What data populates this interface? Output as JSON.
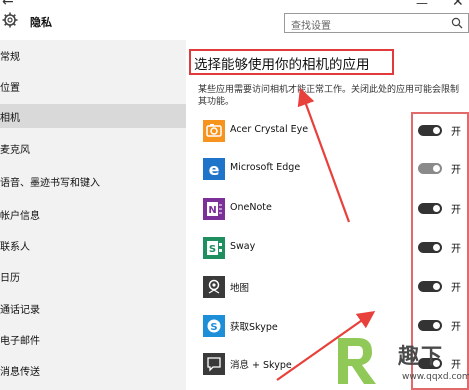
{
  "window": {
    "title": "隐私",
    "search_placeholder": "查找设置"
  },
  "sidebar": {
    "items": [
      {
        "label": "常规"
      },
      {
        "label": "位置"
      },
      {
        "label": "相机",
        "active": true
      },
      {
        "label": "麦克风"
      },
      {
        "label": "语音、墨迹书写和键入"
      },
      {
        "label": "帐户信息"
      },
      {
        "label": "联系人"
      },
      {
        "label": "日历"
      },
      {
        "label": "通话记录"
      },
      {
        "label": "电子邮件"
      },
      {
        "label": "消息传送"
      }
    ]
  },
  "main": {
    "heading": "选择能够使用你的相机的应用",
    "description": "某些应用需要访问相机才能正常工作。关闭此处的应用可能会限制其功能。",
    "apps": [
      {
        "name": "Acer Crystal Eye",
        "icon": "camera-icon",
        "color": "#f7941d",
        "toggle": "开"
      },
      {
        "name": "Microsoft Edge",
        "icon": "edge-icon",
        "color": "#1e74c9",
        "toggle": "开",
        "toggle_dim": true
      },
      {
        "name": "OneNote",
        "icon": "onenote-icon",
        "color": "#7a2f99",
        "toggle": "开"
      },
      {
        "name": "Sway",
        "icon": "sway-icon",
        "color": "#1f8f5f",
        "toggle": "开"
      },
      {
        "name": "地图",
        "icon": "maps-icon",
        "color": "#3a3a3a",
        "toggle": "开"
      },
      {
        "name": "获取Skype",
        "icon": "skype-icon",
        "color": "#1d8fd8",
        "toggle": "开"
      },
      {
        "name": "消息 + Skype",
        "icon": "messaging-icon",
        "color": "#3a3a3a",
        "toggle": "开"
      }
    ]
  },
  "watermark": {
    "text": "趣下",
    "url": "www.qqxd.com"
  },
  "colors": {
    "highlight": "#e03a3a",
    "sidebar_bg": "#f2f2f2"
  }
}
